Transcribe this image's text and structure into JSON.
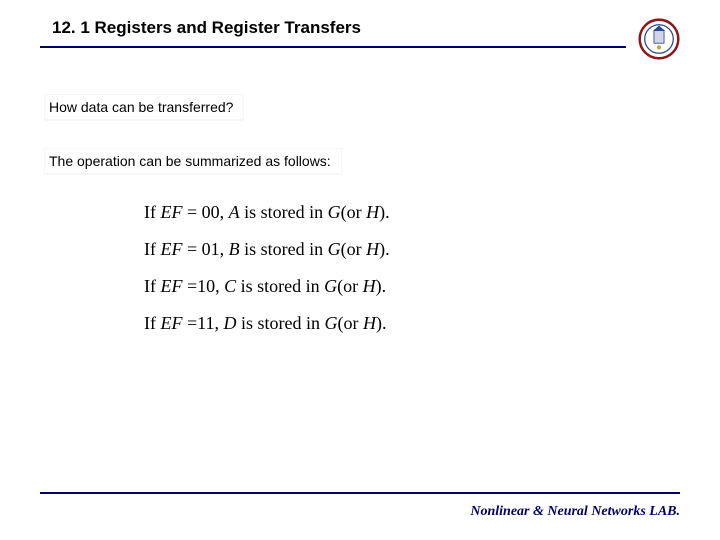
{
  "header": {
    "title": "12. 1 Registers and Register Transfers",
    "logo_name": "university-seal-logo"
  },
  "content": {
    "question": "How data can be transferred?",
    "summary_intro": "The operation can be summarized as follows:",
    "rules": [
      {
        "cond_lhs": "EF",
        "eq": "=",
        "cond_val": "00",
        "reg": "A",
        "stored_in": " is stored in ",
        "dest": "G",
        "or": "(or ",
        "alt": "H",
        "end": ")."
      },
      {
        "cond_lhs": "EF",
        "eq": "=",
        "cond_val": "01",
        "reg": "B",
        "stored_in": " is stored in ",
        "dest": "G",
        "or": "(or ",
        "alt": "H",
        "end": ")."
      },
      {
        "cond_lhs": "EF",
        "eq": "=",
        "cond_val": "10",
        "reg": "C",
        "stored_in": " is stored in ",
        "dest": "G",
        "or": "(or ",
        "alt": "H",
        "end": ")."
      },
      {
        "cond_lhs": "EF",
        "eq": "=",
        "cond_val": "11",
        "reg": "D",
        "stored_in": " is stored in ",
        "dest": "G",
        "or": "(or ",
        "alt": "H",
        "end": ")."
      }
    ],
    "prefix": "If "
  },
  "footer": {
    "lab": "Nonlinear & Neural Networks LAB."
  },
  "colors": {
    "rule": "#000066",
    "footer_text": "#000066"
  }
}
